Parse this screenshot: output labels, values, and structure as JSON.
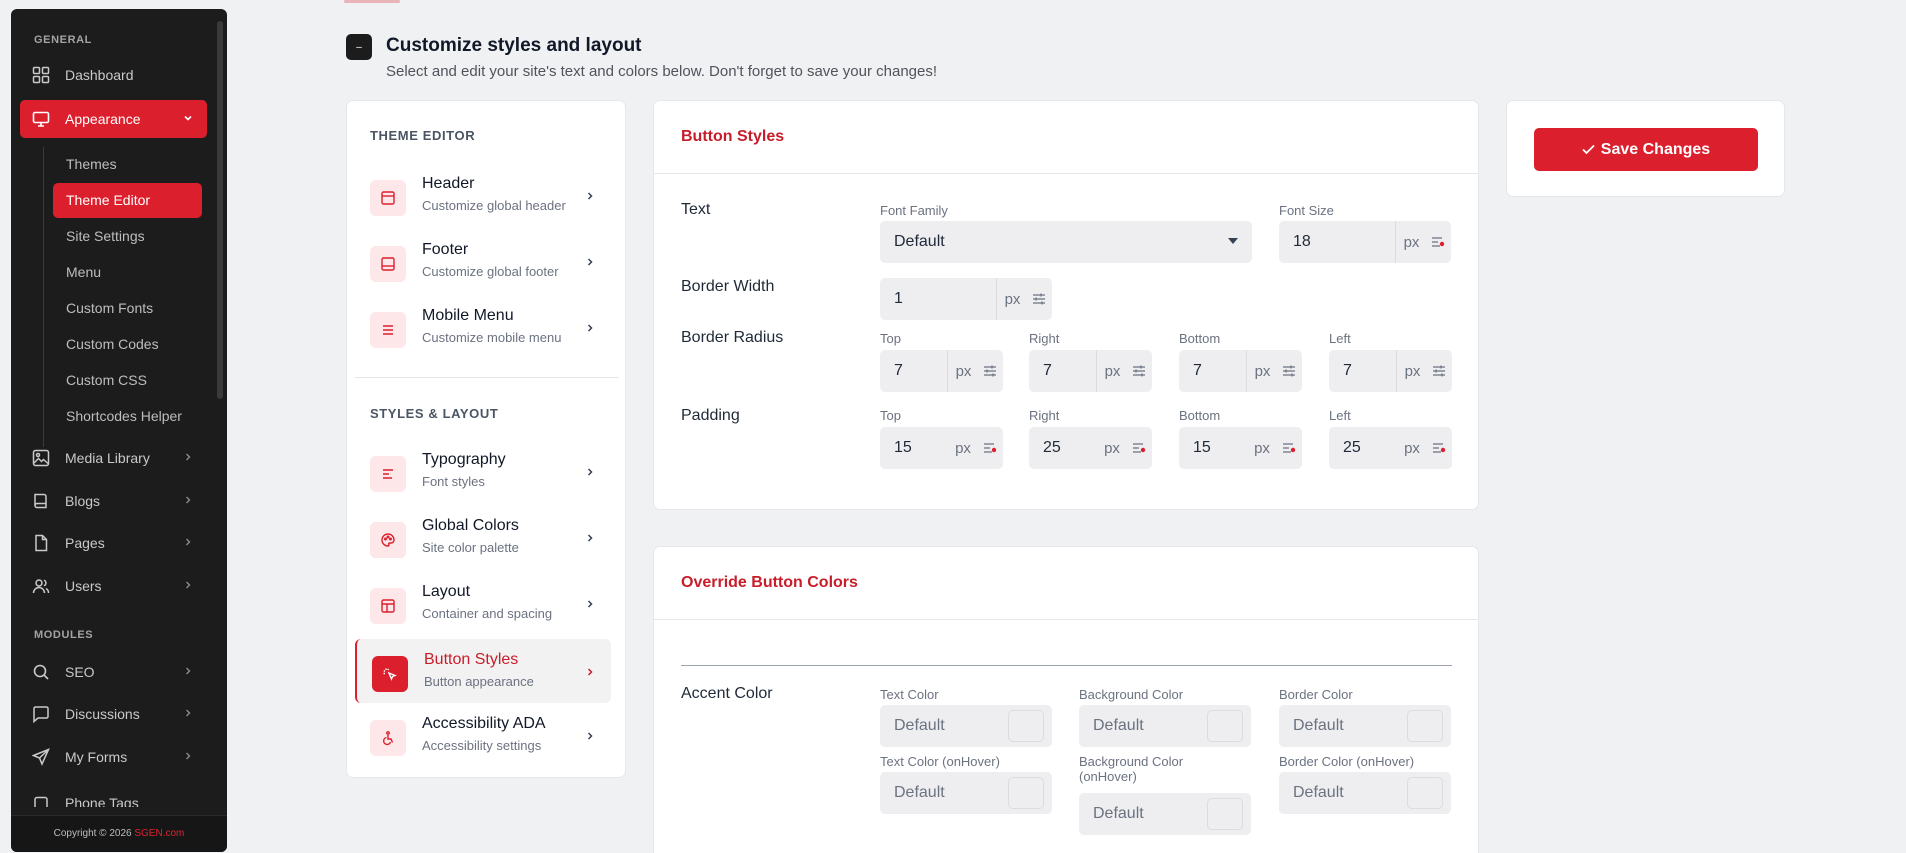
{
  "sidebar": {
    "section_general": "GENERAL",
    "section_modules": "MODULES",
    "items": {
      "dashboard": "Dashboard",
      "appearance": "Appearance",
      "media_library": "Media Library",
      "blogs": "Blogs",
      "pages": "Pages",
      "users": "Users",
      "seo": "SEO",
      "discussions": "Discussions",
      "my_forms": "My Forms",
      "phone_tags": "Phone Tags"
    },
    "sub_items": [
      "Themes",
      "Theme Editor",
      "Site Settings",
      "Menu",
      "Custom Fonts",
      "Custom Codes",
      "Custom CSS",
      "Shortcodes Helper"
    ],
    "footer_text": "Copyright © 2026",
    "footer_brand": "SGEN.com"
  },
  "header": {
    "icon_text": "–",
    "title": "Customize styles and layout",
    "subtitle": "Select and edit your site's text and colors below. Don't forget to save your changes!"
  },
  "nav": {
    "section_theme": "THEME EDITOR",
    "section_styles": "STYLES & LAYOUT",
    "items": [
      {
        "title": "Header",
        "sub": "Customize global header"
      },
      {
        "title": "Footer",
        "sub": "Customize global footer"
      },
      {
        "title": "Mobile Menu",
        "sub": "Customize mobile menu"
      },
      {
        "title": "Typography",
        "sub": "Font styles"
      },
      {
        "title": "Global Colors",
        "sub": "Site color palette"
      },
      {
        "title": "Layout",
        "sub": "Container and spacing"
      },
      {
        "title": "Button Styles",
        "sub": "Button appearance"
      },
      {
        "title": "Accessibility ADA",
        "sub": "Accessibility settings"
      }
    ]
  },
  "button_styles": {
    "title": "Button Styles",
    "text_label": "Text",
    "font_family_label": "Font Family",
    "font_family_value": "Default",
    "font_size_label": "Font Size",
    "font_size_value": "18",
    "unit": "px",
    "border_width_label": "Border Width",
    "border_width_value": "1",
    "border_radius_label": "Border Radius",
    "padding_label": "Padding",
    "side_labels": {
      "top": "Top",
      "right": "Right",
      "bottom": "Bottom",
      "left": "Left"
    },
    "border_radius": {
      "top": "7",
      "right": "7",
      "bottom": "7",
      "left": "7"
    },
    "padding": {
      "top": "15",
      "right": "25",
      "bottom": "15",
      "left": "25"
    }
  },
  "save": {
    "label": "Save Changes"
  },
  "override": {
    "title": "Override Button Colors",
    "accent_label": "Accent Color",
    "fields": {
      "text_color": "Text Color",
      "background_color": "Background Color",
      "border_color": "Border Color",
      "text_color_hover": "Text Color (onHover)",
      "background_color_hover_1": "Background Color",
      "background_color_hover_2": "(onHover)",
      "border_color_hover": "Border Color (onHover)"
    },
    "default_value": "Default"
  },
  "colors": {
    "accent": "#dc1f2d",
    "sidebar_bg": "#1c1c1c",
    "page_bg": "#f0f1f3"
  }
}
